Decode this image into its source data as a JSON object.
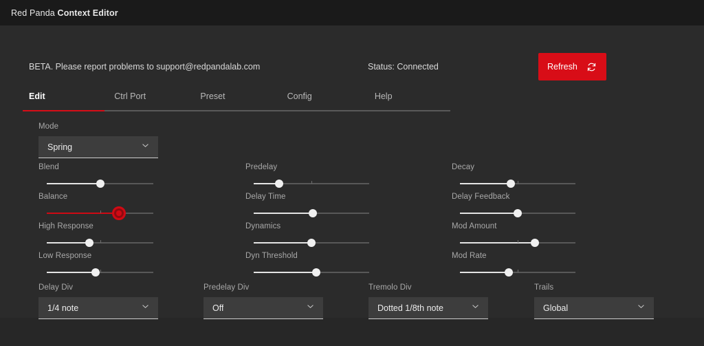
{
  "titlebar": {
    "brand": "Red Panda ",
    "product": "Context Editor"
  },
  "header": {
    "beta_note": "BETA. Please report problems to support@redpandalab.com",
    "status": "Status: Connected",
    "refresh_label": "Refresh",
    "refresh_icon": "refresh-icon",
    "accent_color": "#d80d17"
  },
  "tabs": [
    {
      "label": "Edit",
      "active": true
    },
    {
      "label": "Ctrl Port",
      "active": false
    },
    {
      "label": "Preset",
      "active": false
    },
    {
      "label": "Config",
      "active": false
    },
    {
      "label": "Help",
      "active": false
    }
  ],
  "mode": {
    "label": "Mode",
    "value": "Spring"
  },
  "sliders": {
    "column1": [
      {
        "label": "Blend",
        "percent": 50,
        "active": false,
        "tick": false
      },
      {
        "label": "Balance",
        "percent": 68,
        "active": true,
        "tick": true
      },
      {
        "label": "High Response",
        "percent": 40,
        "active": false,
        "tick": true
      },
      {
        "label": "Low Response",
        "percent": 46,
        "active": false,
        "tick": true
      }
    ],
    "column2": [
      {
        "label": "Predelay",
        "percent": 22,
        "active": false,
        "tick": true
      },
      {
        "label": "Delay Time",
        "percent": 51,
        "active": false,
        "tick": false
      },
      {
        "label": "Dynamics",
        "percent": 50,
        "active": false,
        "tick": false
      },
      {
        "label": "Dyn Threshold",
        "percent": 54,
        "active": false,
        "tick": false
      }
    ],
    "column3": [
      {
        "label": "Decay",
        "percent": 44,
        "active": false,
        "tick": true
      },
      {
        "label": "Delay Feedback",
        "percent": 50,
        "active": false,
        "tick": false
      },
      {
        "label": "Mod Amount",
        "percent": 65,
        "active": false,
        "tick": true
      },
      {
        "label": "Mod Rate",
        "percent": 42,
        "active": false,
        "tick": true
      }
    ]
  },
  "bottom_selects": [
    {
      "label": "Delay Div",
      "value": "1/4 note"
    },
    {
      "label": "Predelay Div",
      "value": "Off"
    },
    {
      "label": "Tremolo Div",
      "value": "Dotted 1/8th note"
    },
    {
      "label": "Trails",
      "value": "Global"
    }
  ]
}
